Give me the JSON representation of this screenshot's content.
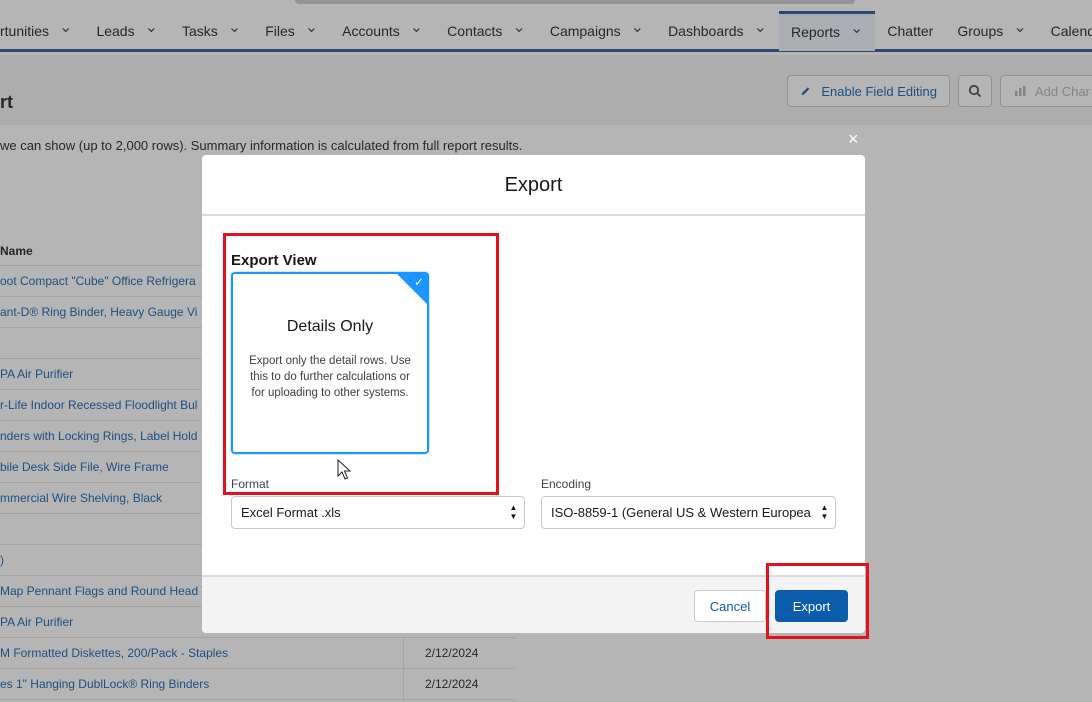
{
  "nav": {
    "items": [
      {
        "label": "rtunities",
        "chevron": true
      },
      {
        "label": "Leads",
        "chevron": true
      },
      {
        "label": "Tasks",
        "chevron": true
      },
      {
        "label": "Files",
        "chevron": true
      },
      {
        "label": "Accounts",
        "chevron": true
      },
      {
        "label": "Contacts",
        "chevron": true
      },
      {
        "label": "Campaigns",
        "chevron": true
      },
      {
        "label": "Dashboards",
        "chevron": true
      },
      {
        "label": "Reports",
        "chevron": true,
        "active": true
      },
      {
        "label": "Chatter",
        "chevron": false
      },
      {
        "label": "Groups",
        "chevron": true
      },
      {
        "label": "Calend",
        "chevron": false
      }
    ]
  },
  "header": {
    "title": "rt",
    "enable_field_editing_label": "Enable Field Editing",
    "add_chart_label": "Add Char"
  },
  "report": {
    "info_text": "we can show (up to 2,000 rows). Summary information is calculated from full report results.",
    "column_header": "Name",
    "rows": [
      {
        "name": "oot Compact \"Cube\" Office Refrigera",
        "date": ""
      },
      {
        "name": "ant-D® Ring Binder, Heavy Gauge Vi",
        "date": ""
      },
      {
        "name": "",
        "date": ""
      },
      {
        "name": "PA Air Purifier",
        "date": ""
      },
      {
        "name": "r-Life Indoor Recessed Floodlight Bul",
        "date": ""
      },
      {
        "name": "nders with Locking Rings, Label Hold",
        "date": ""
      },
      {
        "name": "bile Desk Side File, Wire Frame",
        "date": ""
      },
      {
        "name": "mmercial Wire Shelving, Black",
        "date": ""
      },
      {
        "name": "",
        "date": ""
      },
      {
        "name": ")",
        "date": ""
      },
      {
        "name": "Map Pennant Flags and Round Head T",
        "date": ""
      },
      {
        "name": "PA Air Purifier",
        "date": ""
      },
      {
        "name": "M Formatted Diskettes, 200/Pack - Staples",
        "date": "2/12/2024"
      },
      {
        "name": "es 1\" Hanging DublLock® Ring Binders",
        "date": "2/12/2024"
      }
    ]
  },
  "modal": {
    "title": "Export",
    "close_symbol": "×",
    "export_view_label": "Export View",
    "view_option": {
      "title": "Details Only",
      "description": "Export only the detail rows. Use this to do further calculations or for uploading to other systems.",
      "selected": true
    },
    "format": {
      "label": "Format",
      "value": "Excel Format .xls"
    },
    "encoding": {
      "label": "Encoding",
      "value": "ISO-8859-1 (General US & Western Europea"
    },
    "cancel_label": "Cancel",
    "export_label": "Export"
  },
  "colors": {
    "brand_blue": "#0b5cab",
    "selected_blue": "#1b96ff",
    "highlight_red": "#e3101e",
    "nav_underline": "#1b5297"
  }
}
